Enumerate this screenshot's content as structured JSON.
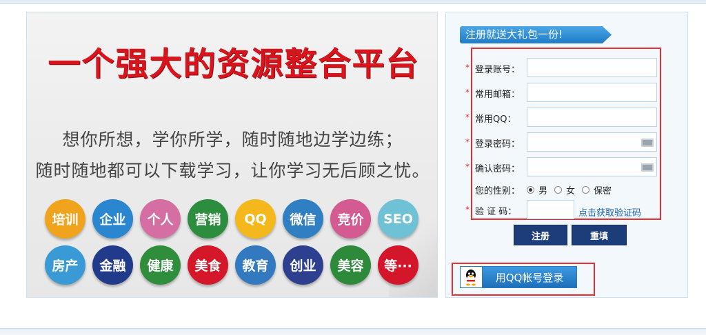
{
  "banner": {
    "title": "一个强大的资源整合平台",
    "line1": "想你所想，学你所学，随时随地边学边练；",
    "line2": "随时随地都可以下载学习，让你学习无后顾之忧。",
    "row1": [
      {
        "text": "培训",
        "color": "#f0a41e"
      },
      {
        "text": "企业",
        "color": "#2a86cf"
      },
      {
        "text": "个人",
        "color": "#d56ea2"
      },
      {
        "text": "营销",
        "color": "#2c8d3e"
      },
      {
        "text": "QQ",
        "color": "#f4b81c"
      },
      {
        "text": "微信",
        "color": "#2f7fc2"
      },
      {
        "text": "竞价",
        "color": "#d35b91"
      },
      {
        "text": "SEO",
        "color": "#6fc1d6"
      }
    ],
    "row2": [
      {
        "text": "房产",
        "color": "#3a9ad6"
      },
      {
        "text": "金融",
        "color": "#223a8a"
      },
      {
        "text": "健康",
        "color": "#2f8e3c"
      },
      {
        "text": "美食",
        "color": "#d4182a"
      },
      {
        "text": "教育",
        "color": "#3279c0"
      },
      {
        "text": "创业",
        "color": "#2d3f8f"
      },
      {
        "text": "美容",
        "color": "#2d8a3a"
      },
      {
        "text": "等···",
        "color": "#d3162a"
      }
    ]
  },
  "register": {
    "ribbon": "注册就送大礼包一份!",
    "fields": {
      "account": {
        "label": "登录账号：",
        "value": ""
      },
      "email": {
        "label": "常用邮箱：",
        "value": ""
      },
      "qq": {
        "label": "常用QQ：",
        "value": ""
      },
      "password": {
        "label": "登录密码：",
        "value": ""
      },
      "confirm": {
        "label": "确认密码：",
        "value": ""
      }
    },
    "gender_label": "您的性别：",
    "gender_options": [
      "男",
      "女",
      "保密"
    ],
    "gender_selected": "男",
    "captcha_label": "验 证 码：",
    "captcha_link": "点击获取验证码",
    "required_mark": "*",
    "register_btn": "注册",
    "reset_btn": "重填",
    "qq_login": "用QQ帐号登录"
  }
}
